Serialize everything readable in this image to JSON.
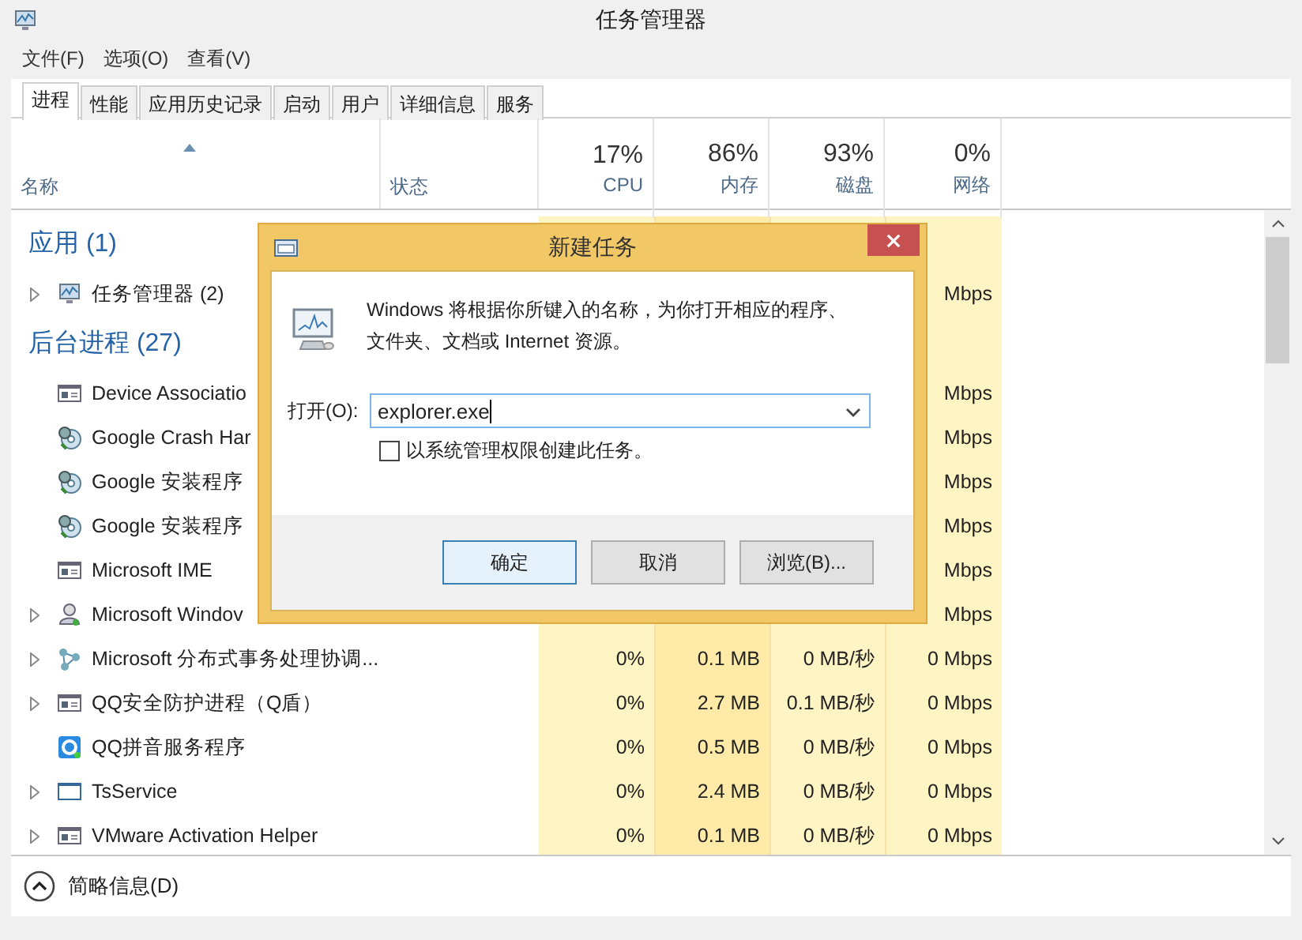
{
  "window": {
    "title": "任务管理器"
  },
  "menu": [
    "文件(F)",
    "选项(O)",
    "查看(V)"
  ],
  "tabs": [
    {
      "label": "进程",
      "selected": true
    },
    {
      "label": "性能",
      "selected": false
    },
    {
      "label": "应用历史记录",
      "selected": false
    },
    {
      "label": "启动",
      "selected": false
    },
    {
      "label": "用户",
      "selected": false
    },
    {
      "label": "详细信息",
      "selected": false
    },
    {
      "label": "服务",
      "selected": false
    }
  ],
  "table": {
    "columns": [
      {
        "label": "名称",
        "sorted": true
      },
      {
        "label": "状态",
        "sorted": false
      },
      {
        "percent": "17%",
        "label": "CPU",
        "sorted": false,
        "color": "#fff4c4"
      },
      {
        "percent": "86%",
        "label": "内存",
        "sorted": false,
        "color": "#ffeaa8"
      },
      {
        "percent": "93%",
        "label": "磁盘",
        "sorted": false,
        "color": "#fff4c4"
      },
      {
        "percent": "0%",
        "label": "网络",
        "sorted": false,
        "color": "#fff4c4"
      }
    ],
    "rows": [
      {
        "kind": "group",
        "name": "应用 (1)"
      },
      {
        "kind": "monitor",
        "expandable": true,
        "name": "任务管理器 (2)",
        "network": "Mbps"
      },
      {
        "kind": "group",
        "name": "后台进程 (27)"
      },
      {
        "kind": "window",
        "expandable": false,
        "name": "Device Associatio",
        "network": "Mbps"
      },
      {
        "kind": "disc",
        "expandable": false,
        "name": "Google Crash Har",
        "network": "Mbps"
      },
      {
        "kind": "disc",
        "expandable": false,
        "name": "Google 安装程序",
        "network": "Mbps"
      },
      {
        "kind": "disc",
        "expandable": false,
        "name": "Google 安装程序",
        "network": "Mbps"
      },
      {
        "kind": "window",
        "expandable": false,
        "name": "Microsoft IME",
        "network": "Mbps"
      },
      {
        "kind": "user",
        "expandable": true,
        "name": "Microsoft Windov",
        "network": "Mbps"
      },
      {
        "kind": "nodes",
        "expandable": true,
        "name": "Microsoft 分布式事务处理协调...",
        "cpu": "0%",
        "memory": "0.1 MB",
        "disk": "0 MB/秒",
        "network": "0 Mbps"
      },
      {
        "kind": "window",
        "expandable": true,
        "name": "QQ安全防护进程（Q盾）",
        "cpu": "0%",
        "memory": "2.7 MB",
        "disk": "0.1 MB/秒",
        "network": "0 Mbps"
      },
      {
        "kind": "qq",
        "expandable": false,
        "name": "QQ拼音服务程序",
        "cpu": "0%",
        "memory": "0.5 MB",
        "disk": "0 MB/秒",
        "network": "0 Mbps"
      },
      {
        "kind": "frame",
        "expandable": true,
        "name": "TsService",
        "cpu": "0%",
        "memory": "2.4 MB",
        "disk": "0 MB/秒",
        "network": "0 Mbps"
      },
      {
        "kind": "window",
        "expandable": true,
        "name": "VMware Activation Helper",
        "cpu": "0%",
        "memory": "0.1 MB",
        "disk": "0 MB/秒",
        "network": "0 Mbps"
      }
    ]
  },
  "footer": {
    "label": "简略信息(D)"
  },
  "dialog": {
    "title": "新建任务",
    "message": "Windows 将根据你所键入的名称，为你打开相应的程序、文件夹、文档或 Internet 资源。",
    "open_label": "打开(O):",
    "value": "explorer.exe",
    "checkbox": {
      "label": "以系统管理权限创建此任务。",
      "checked": false
    },
    "buttons": [
      {
        "label": "确定",
        "default": true
      },
      {
        "label": "取消",
        "default": false
      },
      {
        "label": "浏览(B)...",
        "default": false
      }
    ]
  }
}
